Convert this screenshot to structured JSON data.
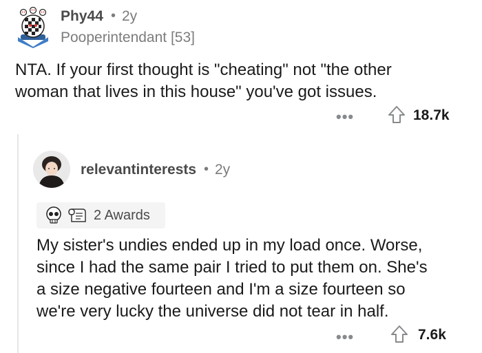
{
  "top_comment": {
    "username": "Phy44",
    "separator": "•",
    "age": "2y",
    "flair": "Pooperintendant [53]",
    "body": "NTA. If your first thought is \"cheating\" not \"the other\nwoman that lives in this house\" you've got issues.",
    "more_label": "•••",
    "score": "18.7k",
    "icons": {
      "avatar": "snoo-avatar-icon",
      "upvote": "upvote-arrow-icon"
    }
  },
  "reply": {
    "username": "relevantinterests",
    "separator": "•",
    "age": "2y",
    "awards_label": "2 Awards",
    "body": "My sister's undies ended up in my load once. Worse,\nsince I had the same pair I tried to put them on. She's\na size negative fourteen and I'm a size fourteen so\nwe're very lucky the universe did not tear in half.",
    "more_label": "•••",
    "score": "7.6k",
    "icons": {
      "avatar": "user-avatar-icon",
      "award1": "skull-award-icon",
      "award2": "scroll-award-icon",
      "upvote": "upvote-arrow-icon"
    }
  }
}
